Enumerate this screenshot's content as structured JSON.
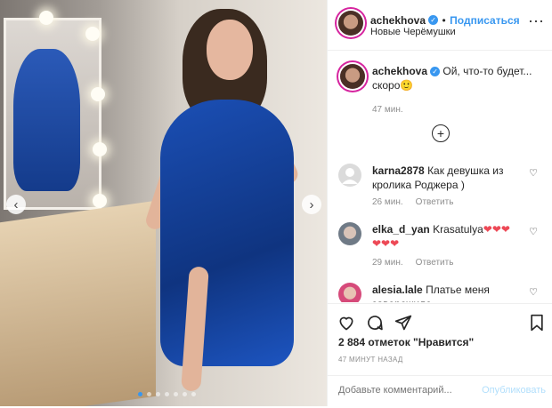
{
  "header": {
    "username": "achekhova",
    "follow_label": "Подписаться",
    "location": "Новые Черёмушки"
  },
  "caption": {
    "username": "achekhova",
    "text": "Ой, что-то будет... скоро",
    "emoji": "🙂",
    "time": "47 мин."
  },
  "comments": [
    {
      "username": "karna2878",
      "text": "Как девушка из кролика Роджера )",
      "time": "26 мин.",
      "reply_label": "Ответить"
    },
    {
      "username": "elka_d_yan",
      "text": "Krasatulya",
      "hearts_inline": "❤❤❤",
      "hearts_line2": "❤❤❤",
      "time": "29 мин.",
      "reply_label": "Ответить"
    },
    {
      "username": "alesia.lale",
      "text": "Платье меня заворожило"
    }
  ],
  "actions": {
    "likes": "2 884 отметок \"Нравится\"",
    "posted_ago": "47 МИНУТ НАЗАД",
    "comment_placeholder": "Добавьте комментарий...",
    "publish_label": "Опубликовать"
  },
  "carousel": {
    "slide_count": 7,
    "active_index": 0
  },
  "icons": [
    "verified-icon",
    "more-icon",
    "plus-circle-icon",
    "heart-icon",
    "comment-icon",
    "share-icon",
    "bookmark-icon",
    "chevron-left-icon",
    "chevron-right-icon"
  ],
  "colors": {
    "accent": "#3897f0",
    "text": "#262626",
    "muted": "#8e8e8e",
    "heart_red": "#ed4956",
    "dress_blue": "#1b4fb5"
  }
}
